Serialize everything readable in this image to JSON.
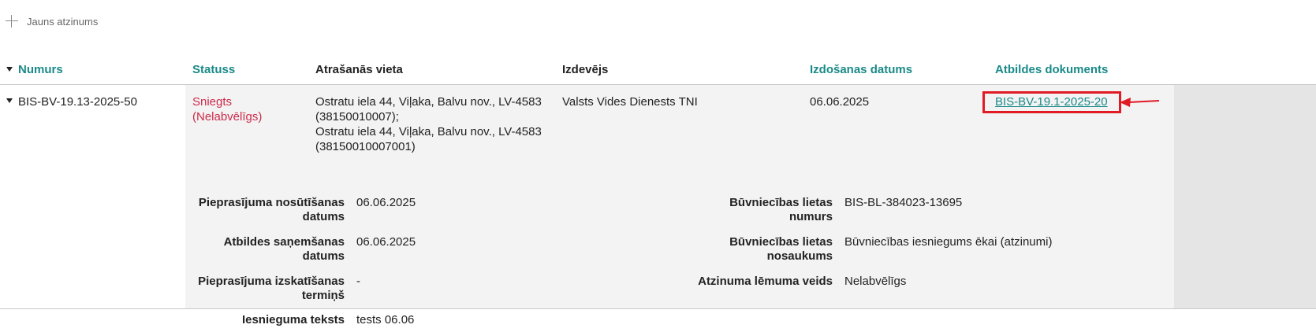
{
  "toolbar": {
    "new_label": "Jauns atzinums",
    "new_icon": "plus-icon"
  },
  "table": {
    "headers": {
      "numurs": "Numurs",
      "statuss": "Statuss",
      "vieta": "Atrašanās vieta",
      "izdevejs": "Izdevējs",
      "datums": "Izdošanas datums",
      "dokuments": "Atbildes dokuments"
    },
    "rows": [
      {
        "numurs": "BIS-BV-19.13-2025-50",
        "status_line1": "Sniegts",
        "status_line2": "(Nelabvēlīgs)",
        "location_lines": [
          "Ostratu iela 44, Viļaka, Balvu nov., LV-4583",
          "(38150010007);",
          "Ostratu iela 44, Viļaka, Balvu nov., LV-4583",
          "(38150010007001)"
        ],
        "izdevejs": "Valsts Vides Dienests TNI",
        "datums": "06.06.2025",
        "dokuments": "BIS-BV-19.1-2025-20",
        "details_left": [
          {
            "label1": "Pieprasījuma nosūtīšanas",
            "label2": "datums",
            "value": "06.06.2025"
          },
          {
            "label1": "Atbildes saņemšanas",
            "label2": "datums",
            "value": "06.06.2025"
          },
          {
            "label1": "Pieprasījuma izskatīšanas",
            "label2": "termiņš",
            "value": "-"
          },
          {
            "label1": "Iesnieguma teksts",
            "label2": "",
            "value": "tests 06.06"
          }
        ],
        "details_right": [
          {
            "label1": "Būvniecības lietas",
            "label2": "numurs",
            "value": "BIS-BL-384023-13695"
          },
          {
            "label1": "Būvniecības lietas",
            "label2": "nosaukums",
            "value": "Būvniecības iesniegums ēkai (atzinumi)"
          },
          {
            "label1": "Atzinuma lēmuma veids",
            "label2": "",
            "value": "Nelabvēlīgs"
          }
        ]
      }
    ]
  },
  "colors": {
    "accent": "#1a8a88",
    "status": "#cc2a4a",
    "highlight": "#e01b24"
  }
}
